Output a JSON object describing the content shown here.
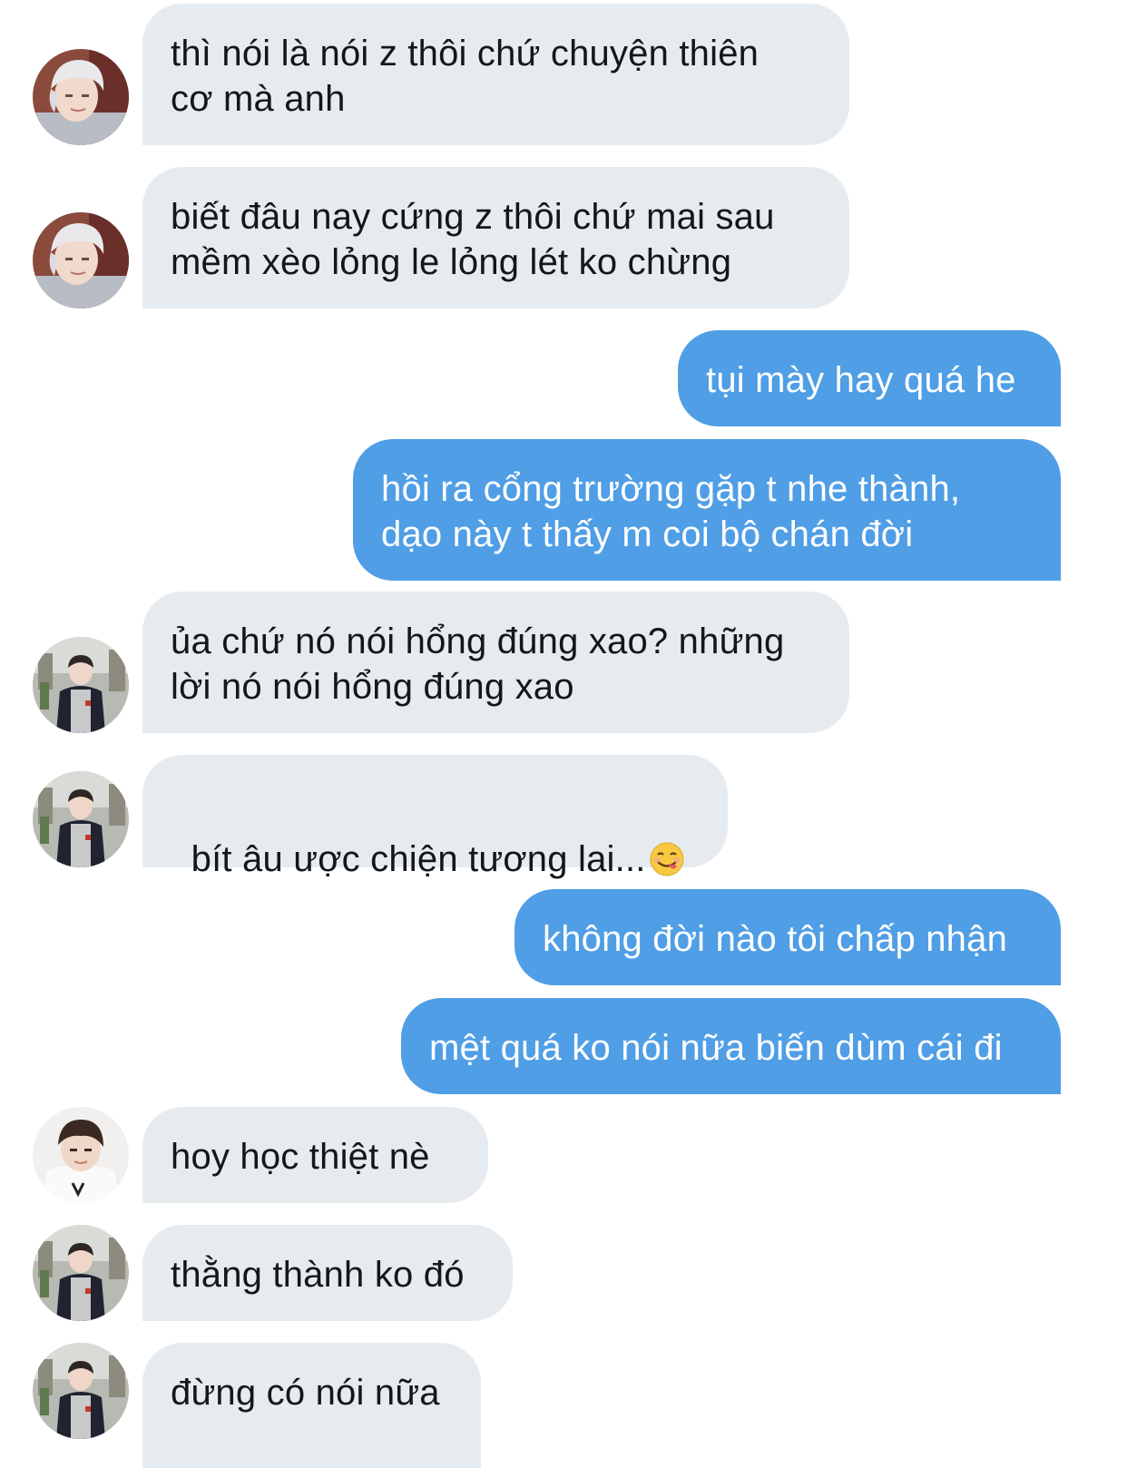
{
  "conversation": {
    "messages": [
      {
        "direction": "incoming",
        "sender_avatar": "avatar-silver-hair",
        "text": "thì nói là nói z thôi chứ chuyện thiên\ncơ mà anh"
      },
      {
        "direction": "incoming",
        "sender_avatar": "avatar-silver-hair",
        "text": "biết đâu nay cứng z thôi chứ mai sau\nmềm xèo lỏng le lỏng lét ko chừng"
      },
      {
        "direction": "outgoing",
        "text": "tụi mày hay quá he"
      },
      {
        "direction": "outgoing",
        "text": "hồi ra cổng trường gặp t nhe thành,\ndạo này t thấy m coi bộ chán đời"
      },
      {
        "direction": "incoming",
        "sender_avatar": "avatar-dark-jacket",
        "text": "ủa chứ nó nói hổng đúng xao? những\nlời nó nói hổng đúng xao"
      },
      {
        "direction": "incoming",
        "sender_avatar": "avatar-dark-jacket",
        "text": "bít âu ược chiện tương lai...",
        "emoji": "yum-face-emoji"
      },
      {
        "direction": "outgoing",
        "text": "không đời nào tôi chấp nhận"
      },
      {
        "direction": "outgoing",
        "text": "mệt quá ko nói nữa biến dùm cái đi"
      },
      {
        "direction": "incoming",
        "sender_avatar": "avatar-white-shirt",
        "text": "hoy học thiệt nè"
      },
      {
        "direction": "incoming",
        "sender_avatar": "avatar-dark-jacket",
        "text": "thằng thành ko đó"
      },
      {
        "direction": "incoming",
        "sender_avatar": "avatar-dark-jacket",
        "text": "đừng có nói nữa"
      }
    ]
  },
  "colors": {
    "incoming_bubble": "#e6ebef",
    "outgoing_bubble": "#4f9ee6",
    "incoming_text": "#14171a",
    "outgoing_text": "#ffffff"
  }
}
